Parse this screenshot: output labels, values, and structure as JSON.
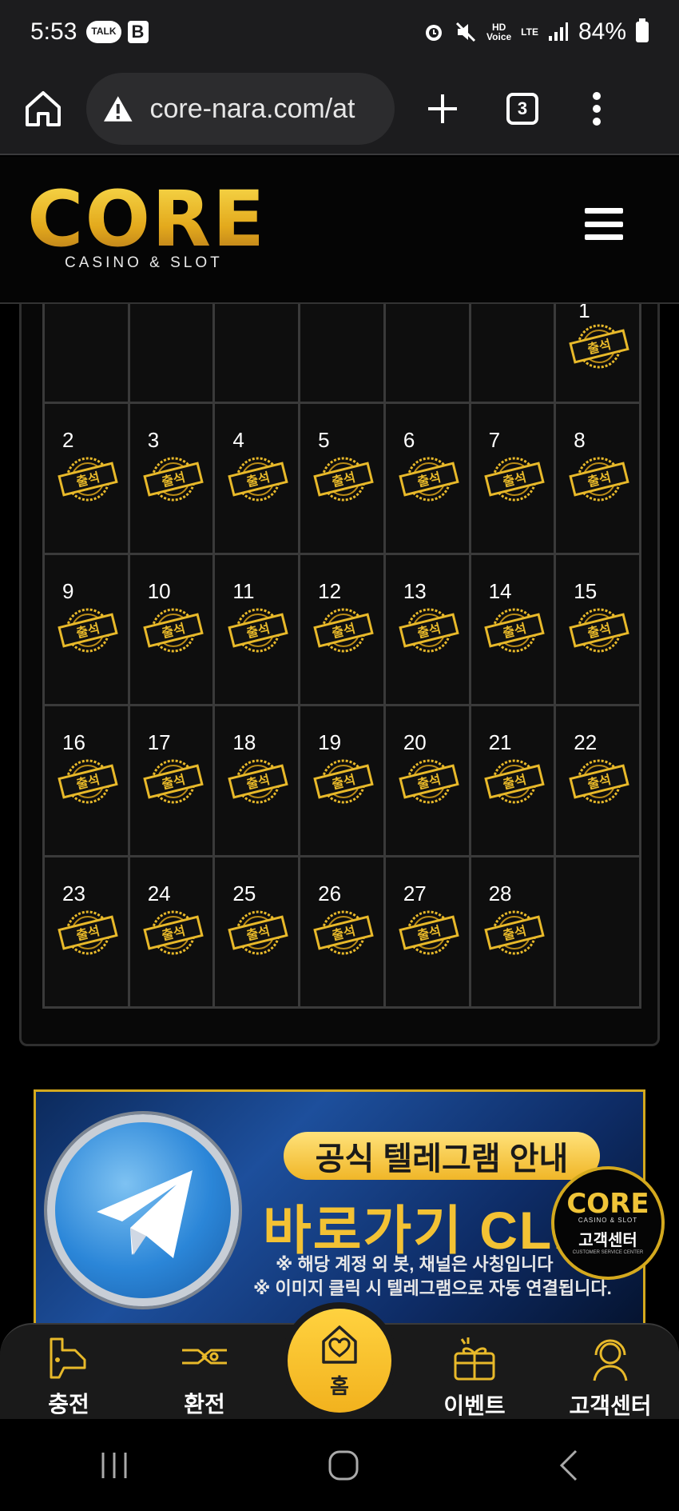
{
  "status_bar": {
    "time": "5:53",
    "talk_badge": "TALK",
    "b_badge": "B",
    "hd_voice": "HD\nVoice",
    "lte": "LTE",
    "battery": "84%"
  },
  "browser": {
    "url": "core-nara.com/at",
    "tab_count": "3"
  },
  "site": {
    "logo_text": "CORE",
    "logo_sub": "CASINO & SLOT"
  },
  "calendar": {
    "stamp_label": "출석",
    "first_row": [
      "",
      "",
      "",
      "",
      "",
      "",
      "1"
    ],
    "rows": [
      [
        "2",
        "3",
        "4",
        "5",
        "6",
        "7",
        "8"
      ],
      [
        "9",
        "10",
        "11",
        "12",
        "13",
        "14",
        "15"
      ],
      [
        "16",
        "17",
        "18",
        "19",
        "20",
        "21",
        "22"
      ],
      [
        "23",
        "24",
        "25",
        "26",
        "27",
        "28",
        ""
      ]
    ]
  },
  "banner": {
    "pill_text": "공식 텔레그램 안내",
    "big_text": "바로가기 CLIC",
    "note1": "※ 해당 계정 외 봇, 채널은 사칭입니다",
    "note2": "※ 이미지 클릭 시 텔레그램으로 자동 연결됩니다."
  },
  "cs_badge": {
    "core": "CORE",
    "sub": "CASINO & SLOT",
    "label": "고객센터",
    "tiny": "CUSTOMER SERVICE CENTER"
  },
  "bottom_nav": {
    "deposit": "충전",
    "withdraw": "환전",
    "home": "홈",
    "event": "이벤트",
    "support": "고객센터"
  },
  "colors": {
    "gold": "#e8b92a",
    "background": "#000000",
    "cell": "#0e0e0e"
  }
}
